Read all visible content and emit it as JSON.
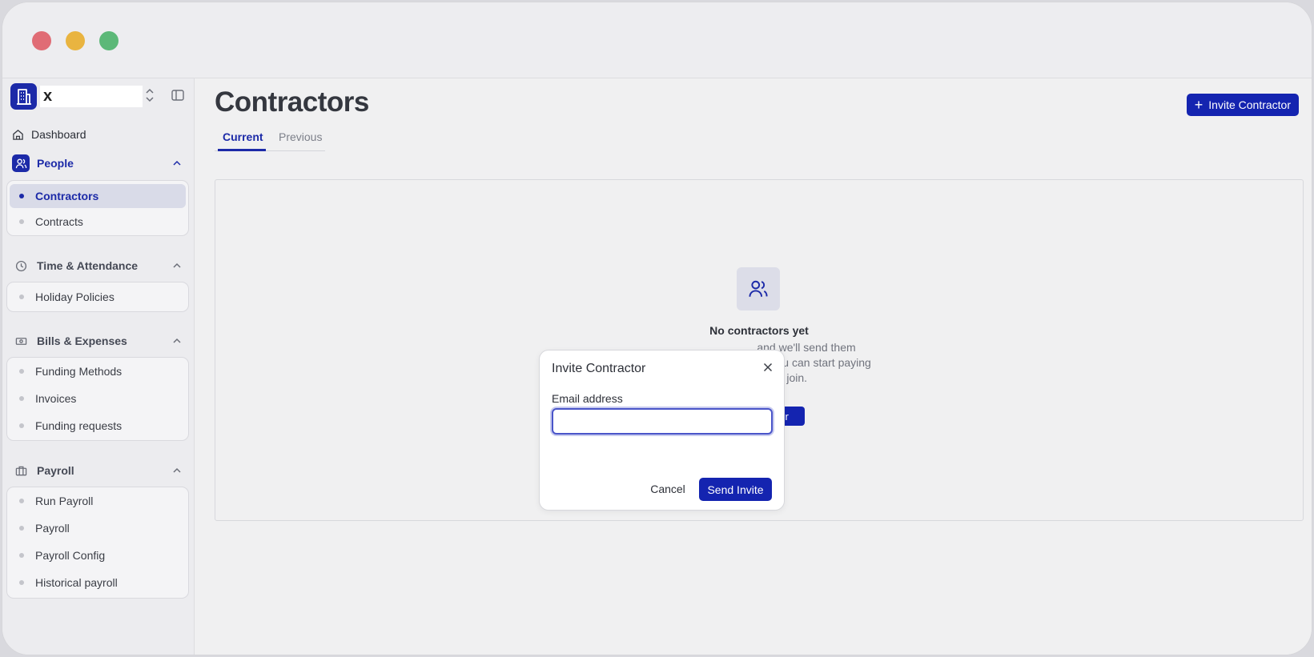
{
  "sidebar": {
    "workspace_name": "x",
    "dashboard": "Dashboard",
    "sections": [
      {
        "label": "People",
        "items": [
          "Contractors",
          "Contracts"
        ]
      },
      {
        "label": "Time & Attendance",
        "items": [
          "Holiday Policies"
        ]
      },
      {
        "label": "Bills & Expenses",
        "items": [
          "Funding Methods",
          "Invoices",
          "Funding requests"
        ]
      },
      {
        "label": "Payroll",
        "items": [
          "Run Payroll",
          "Payroll",
          "Payroll Config",
          "Historical payroll"
        ]
      }
    ]
  },
  "main": {
    "title": "Contractors",
    "invite_button": "Invite Contractor",
    "tabs": [
      "Current",
      "Previous"
    ],
    "empty": {
      "title": "No contractors yet",
      "text": "and we'll send them p. You can start paying hey join.",
      "button": "ctor"
    }
  },
  "modal": {
    "title": "Invite Contractor",
    "email_label": "Email address",
    "email_value": "",
    "cancel": "Cancel",
    "send": "Send Invite"
  },
  "colors": {
    "accent": "#1424b0",
    "active_bg": "#d9dbe8"
  }
}
